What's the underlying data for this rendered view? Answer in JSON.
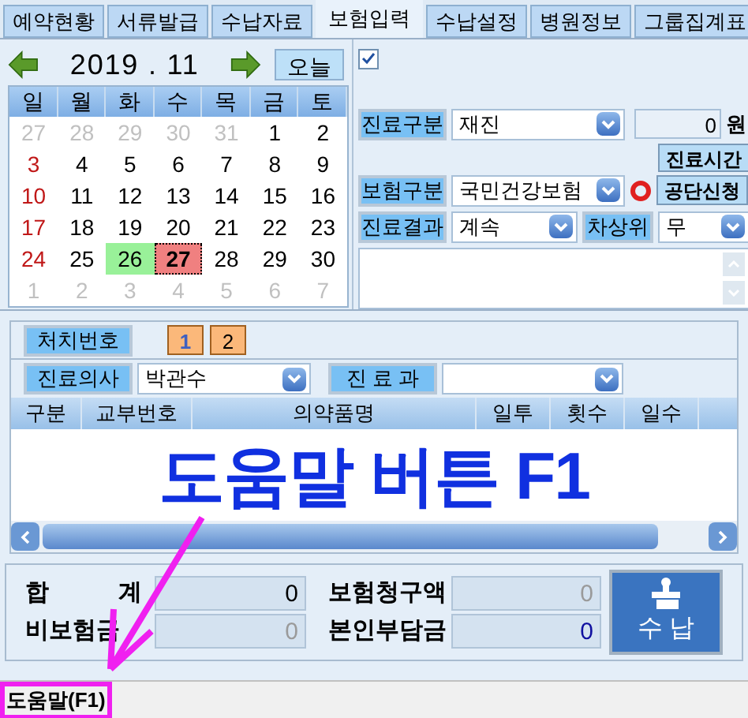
{
  "tabs": [
    {
      "label": "예약현황",
      "selected": false
    },
    {
      "label": "서류발급",
      "selected": false
    },
    {
      "label": "수납자료",
      "selected": false
    },
    {
      "label": "보험입력",
      "selected": true
    },
    {
      "label": "수납설정",
      "selected": false
    },
    {
      "label": "병원정보",
      "selected": false
    },
    {
      "label": "그룹집계표",
      "selected": false
    }
  ],
  "calendar": {
    "month": "2019 . 11",
    "today_button": "오늘",
    "weekdays": [
      "일",
      "월",
      "화",
      "수",
      "목",
      "금",
      "토"
    ],
    "weeks": [
      [
        {
          "text": "27",
          "kind": "other"
        },
        {
          "text": "28",
          "kind": "other"
        },
        {
          "text": "29",
          "kind": "other"
        },
        {
          "text": "30",
          "kind": "other"
        },
        {
          "text": "31",
          "kind": "other"
        },
        {
          "text": "1",
          "kind": "normal"
        },
        {
          "text": "2",
          "kind": "normal"
        }
      ],
      [
        {
          "text": "3",
          "kind": "normal"
        },
        {
          "text": "4",
          "kind": "normal"
        },
        {
          "text": "5",
          "kind": "normal"
        },
        {
          "text": "6",
          "kind": "normal"
        },
        {
          "text": "7",
          "kind": "normal"
        },
        {
          "text": "8",
          "kind": "normal"
        },
        {
          "text": "9",
          "kind": "normal"
        }
      ],
      [
        {
          "text": "10",
          "kind": "normal"
        },
        {
          "text": "11",
          "kind": "normal"
        },
        {
          "text": "12",
          "kind": "normal"
        },
        {
          "text": "13",
          "kind": "normal"
        },
        {
          "text": "14",
          "kind": "normal"
        },
        {
          "text": "15",
          "kind": "normal"
        },
        {
          "text": "16",
          "kind": "normal"
        }
      ],
      [
        {
          "text": "17",
          "kind": "normal"
        },
        {
          "text": "18",
          "kind": "normal"
        },
        {
          "text": "19",
          "kind": "normal"
        },
        {
          "text": "20",
          "kind": "normal"
        },
        {
          "text": "21",
          "kind": "normal"
        },
        {
          "text": "22",
          "kind": "normal"
        },
        {
          "text": "23",
          "kind": "normal"
        }
      ],
      [
        {
          "text": "24",
          "kind": "normal"
        },
        {
          "text": "25",
          "kind": "normal"
        },
        {
          "text": "26",
          "kind": "marked"
        },
        {
          "text": "27",
          "kind": "selected"
        },
        {
          "text": "28",
          "kind": "normal"
        },
        {
          "text": "29",
          "kind": "normal"
        },
        {
          "text": "30",
          "kind": "normal"
        }
      ],
      [
        {
          "text": "1",
          "kind": "other"
        },
        {
          "text": "2",
          "kind": "other"
        },
        {
          "text": "3",
          "kind": "other"
        },
        {
          "text": "4",
          "kind": "other"
        },
        {
          "text": "5",
          "kind": "other"
        },
        {
          "text": "6",
          "kind": "other"
        },
        {
          "text": "7",
          "kind": "other"
        }
      ]
    ]
  },
  "checkbox": {
    "checked": true
  },
  "form": {
    "visit_label": "진료구분",
    "visit_value": "재진",
    "amount": "0",
    "currency": "원",
    "time_button": "진료시간",
    "insurance_label": "보험구분",
    "insurance_value": "국민건강보험",
    "apply_button": "공단신청",
    "result_label": "진료결과",
    "result_value": "계속",
    "rank_label": "차상위",
    "rank_value": "무"
  },
  "treatment": {
    "label": "처치번호",
    "numbers": [
      {
        "text": "1",
        "selected": true
      },
      {
        "text": "2",
        "selected": false
      }
    ],
    "doctor_label": "진료의사",
    "doctor_value": "박관수",
    "dept_label": "진 료 과"
  },
  "table": {
    "columns": [
      "구분",
      "교부번호",
      "의약품명",
      "일투",
      "횟수",
      "일수"
    ]
  },
  "overlay_text": "도움말 버튼 F1",
  "summary": [
    {
      "label": "합",
      "label_2": "계",
      "value": "0",
      "kind": "normal"
    },
    {
      "label": "보험청구액",
      "value": "0",
      "kind": "disabled"
    },
    {
      "label": "비보험금",
      "value": "0",
      "kind": "disabled"
    },
    {
      "label": "본인부담금",
      "value": "0",
      "kind": "highlight"
    }
  ],
  "pay_button": "수 납",
  "status_bar": "도움말(F1)"
}
